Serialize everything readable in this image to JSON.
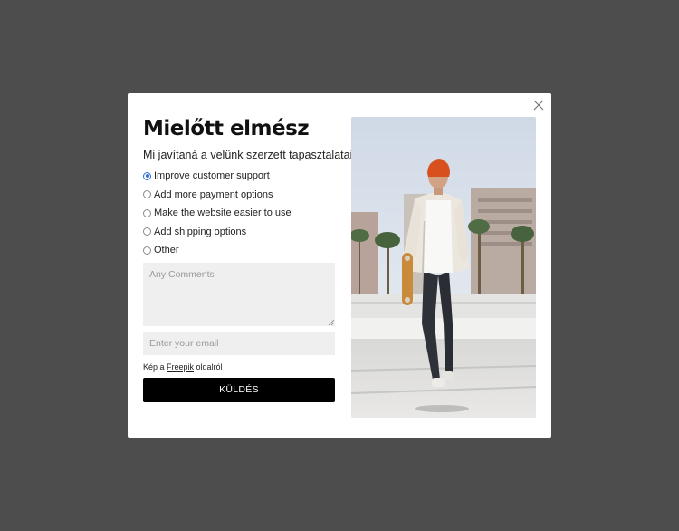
{
  "modal": {
    "title": "Mielőtt elmész",
    "question": "Mi javítaná a velünk szerzett tapasztalatait?",
    "options": [
      {
        "label": "Improve customer support",
        "checked": true
      },
      {
        "label": "Add more payment options",
        "checked": false
      },
      {
        "label": "Make the website easier to use",
        "checked": false
      },
      {
        "label": "Add shipping options",
        "checked": false
      },
      {
        "label": "Other",
        "checked": false
      }
    ],
    "comments_placeholder": "Any Comments",
    "email_placeholder": "Enter your email",
    "credit_prefix": "Kép a ",
    "credit_link": "Freepik",
    "credit_suffix": " oldalról",
    "submit_label": "KÜLDÉS",
    "close_icon": "close-icon",
    "accent_color": "#2b6fd6",
    "overlay_color": "#4d4d4d"
  }
}
